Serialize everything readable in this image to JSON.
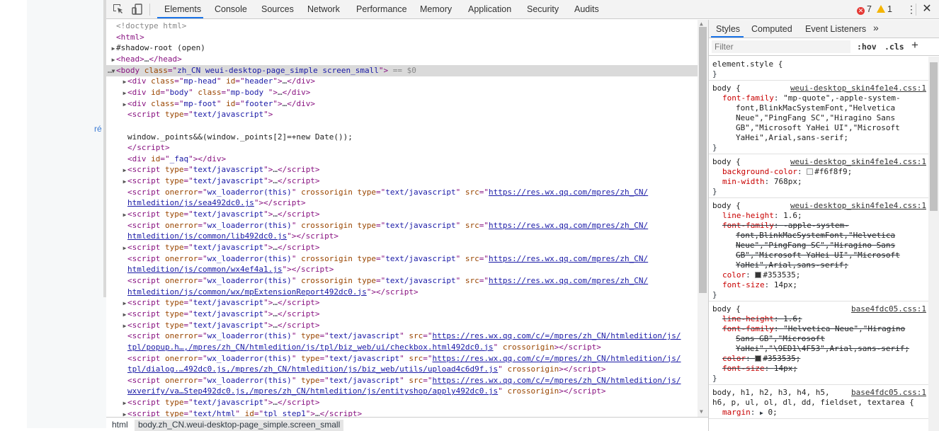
{
  "page": {
    "fragment": "ré"
  },
  "toolbar": {
    "tabs": [
      {
        "label": "Elements"
      },
      {
        "label": "Console"
      },
      {
        "label": "Sources"
      },
      {
        "label": "Network"
      },
      {
        "label": "Performance"
      },
      {
        "label": "Memory"
      },
      {
        "label": "Application"
      },
      {
        "label": "Security"
      },
      {
        "label": "Audits"
      }
    ],
    "error_count": "7",
    "warning_count": "1",
    "error_glyph": "✕",
    "close_glyph": "✕",
    "more_glyph": "⋮"
  },
  "elements": {
    "selected_suffix": " == $0",
    "ellipsis": "…"
  },
  "breadcrumb": {
    "items": [
      {
        "label": "html"
      },
      {
        "label": "body.zh_CN.weui-desktop-page_simple.screen_small"
      }
    ]
  },
  "styles": {
    "tabs": [
      {
        "label": "Styles"
      },
      {
        "label": "Computed"
      },
      {
        "label": "Event Listeners"
      },
      {
        "label": "»"
      }
    ],
    "filter_placeholder": "Filter",
    "hov": ":hov",
    "cls": ".cls",
    "plus": "+",
    "rules": [
      {
        "selector": "element.style {",
        "close": "}"
      },
      {
        "selector": "body {",
        "source": "weui-desktop_skin4fe1e4.css:1",
        "props": [
          {
            "name": "font-family",
            "value": "\"mp-quote\",-apple-system-"
          },
          {
            "cont": "font,BlinkMacSystemFont,\"Helvetica"
          },
          {
            "cont": "Neue\",\"PingFang SC\",\"Hiragino Sans"
          },
          {
            "cont": "GB\",\"Microsoft YaHei UI\",\"Microsoft"
          },
          {
            "cont": "YaHei\",Arial,sans-serif;"
          }
        ],
        "close": "}"
      },
      {
        "selector": "body {",
        "source": "weui-desktop_skin4fe1e4.css:1",
        "props": [
          {
            "name": "background-color",
            "value": "#f6f8f9;",
            "swatch": "#f6f8f9"
          },
          {
            "name": "min-width",
            "value": "768px;"
          }
        ],
        "close": "}"
      },
      {
        "selector": "body {",
        "source": "weui-desktop_skin4fe1e4.css:1",
        "props": [
          {
            "name": "line-height",
            "value": "1.6;"
          },
          {
            "name": "font-family",
            "value": "-apple-system-",
            "struck": true
          },
          {
            "cont": "font,BlinkMacSystemFont,\"Helvetica",
            "struck": true
          },
          {
            "cont": "Neue\",\"PingFang SC\",\"Hiragino Sans",
            "struck": true
          },
          {
            "cont": "GB\",\"Microsoft YaHei UI\",\"Microsoft",
            "struck": true
          },
          {
            "cont": "YaHei\",Arial,sans-serif;",
            "struck": true
          },
          {
            "name": "color",
            "value": "#353535;",
            "swatch": "#353535"
          },
          {
            "name": "font-size",
            "value": "14px;"
          }
        ],
        "close": "}"
      },
      {
        "selector": "body {",
        "source": "base4fdc05.css:1",
        "props": [
          {
            "name": "line-height",
            "value": "1.6;",
            "struck": true
          },
          {
            "name": "font-family",
            "value": "\"Helvetica Neue\",\"Hiragino",
            "struck": true
          },
          {
            "cont": "Sans GB\",\"Microsoft",
            "struck": true
          },
          {
            "cont": "YaHei\",\"\\9ED1\\4F53\",Arial,sans-serif;",
            "struck": true
          },
          {
            "name": "color",
            "value": "#353535;",
            "swatch": "#353535",
            "struck": true
          },
          {
            "name": "font-size",
            "value": "14px;",
            "struck": true
          }
        ],
        "close": "}"
      },
      {
        "selector": "body, h1, h2, h3, h4, h5,",
        "selector2": "h6, p, ul, ol, dl, dd, fieldset, textarea {",
        "source": "base4fdc05.css:1",
        "props": [
          {
            "name": "margin",
            "value": "0;",
            "arrow": "▶"
          }
        ]
      }
    ]
  },
  "dom_lines": [
    {
      "d": 0,
      "html": "<span class='cm'>&lt;!doctype html&gt;</span>"
    },
    {
      "d": 0,
      "html": "<span class='tag'>&lt;html&gt;</span>"
    },
    {
      "d": 0,
      "tri": "▶",
      "html": "<span class='tx'>#shadow-root (open)</span>"
    },
    {
      "d": 0,
      "tri": "▶",
      "html": "<span class='tag'>&lt;head&gt;</span>…<span class='tag'>&lt;/head&gt;</span>"
    },
    {
      "d": 0,
      "tri": "▼",
      "sel": true,
      "html": "<span class='tag'>&lt;body</span> <span class='an'>class</span><span class='tag'>=\"</span><span class='av'>zh_CN weui-desktop-page_simple  screen_small</span><span class='tag'>\"&gt;</span>"
    },
    {
      "d": 1,
      "tri": "▶",
      "html": "<span class='tag'>&lt;div</span> <span class='an'>class</span><span class='tag'>=\"</span><span class='av'>mp-head</span><span class='tag'>\"</span> <span class='an'>id</span><span class='tag'>=\"</span><span class='av'>header</span><span class='tag'>\"&gt;</span>…<span class='tag'>&lt;/div&gt;</span>"
    },
    {
      "d": 1,
      "tri": "▶",
      "html": "<span class='tag'>&lt;div</span> <span class='an'>id</span><span class='tag'>=\"</span><span class='av'>body</span><span class='tag'>\"</span> <span class='an'>class</span><span class='tag'>=\"</span><span class='av'>mp-body </span><span class='tag'>\"&gt;</span>…<span class='tag'>&lt;/div&gt;</span>"
    },
    {
      "d": 1,
      "tri": "▶",
      "html": "<span class='tag'>&lt;div</span> <span class='an'>class</span><span class='tag'>=\"</span><span class='av'>mp-foot</span><span class='tag'>\"</span> <span class='an'>id</span><span class='tag'>=\"</span><span class='av'>footer</span><span class='tag'>\"&gt;</span>…<span class='tag'>&lt;/div&gt;</span>"
    },
    {
      "d": 1,
      "html": "<span class='tag'>&lt;script</span> <span class='an'>type</span><span class='tag'>=\"</span><span class='av'>text/javascript</span><span class='tag'>\"&gt;</span>"
    },
    {
      "d": 1,
      "html": ""
    },
    {
      "d": 1,
      "html": "<span class='tx'>window._points&amp;&amp;(window._points[2]=+new Date());</span>"
    },
    {
      "d": 1,
      "html": "<span class='tag'>&lt;/script&gt;</span>"
    },
    {
      "d": 1,
      "html": "<span class='tag'>&lt;div</span> <span class='an'>id</span><span class='tag'>=\"</span><span class='av'>_faq</span><span class='tag'>\"&gt;&lt;/div&gt;</span>"
    },
    {
      "d": 1,
      "tri": "▶",
      "html": "<span class='tag'>&lt;script</span> <span class='an'>type</span><span class='tag'>=\"</span><span class='av'>text/javascript</span><span class='tag'>\"&gt;</span>…<span class='tag'>&lt;/script&gt;</span>"
    },
    {
      "d": 1,
      "tri": "▶",
      "html": "<span class='tag'>&lt;script</span> <span class='an'>type</span><span class='tag'>=\"</span><span class='av'>text/javascript</span><span class='tag'>\"&gt;</span>…<span class='tag'>&lt;/script&gt;</span>"
    },
    {
      "d": 1,
      "html": "<span class='tag'>&lt;script</span> <span class='an'>onerror</span><span class='tag'>=\"</span><span class='av'>wx_loaderror(this)</span><span class='tag'>\"</span> <span class='an'>crossorigin type</span><span class='tag'>=\"</span><span class='av'>text/javascript</span><span class='tag'>\"</span> <span class='an'>src</span><span class='tag'>=\"</span><span class='lk'>https://res.wx.qq.com/mpres/zh_CN/</span>"
    },
    {
      "d": 1,
      "html": "<span class='lk'>htmledition/js/sea492dc0.js</span><span class='tag'>\"&gt;&lt;/script&gt;</span>"
    },
    {
      "d": 1,
      "tri": "▶",
      "html": "<span class='tag'>&lt;script</span> <span class='an'>type</span><span class='tag'>=\"</span><span class='av'>text/javascript</span><span class='tag'>\"&gt;</span>…<span class='tag'>&lt;/script&gt;</span>"
    },
    {
      "d": 1,
      "html": "<span class='tag'>&lt;script</span> <span class='an'>onerror</span><span class='tag'>=\"</span><span class='av'>wx_loaderror(this)</span><span class='tag'>\"</span> <span class='an'>crossorigin type</span><span class='tag'>=\"</span><span class='av'>text/javascript</span><span class='tag'>\"</span> <span class='an'>src</span><span class='tag'>=\"</span><span class='lk'>https://res.wx.qq.com/mpres/zh_CN/</span>"
    },
    {
      "d": 1,
      "html": "<span class='lk'>htmledition/js/common/lib492dc0.js</span><span class='tag'>\"&gt;&lt;/script&gt;</span>"
    },
    {
      "d": 1,
      "tri": "▶",
      "html": "<span class='tag'>&lt;script</span> <span class='an'>type</span><span class='tag'>=\"</span><span class='av'>text/javascript</span><span class='tag'>\"&gt;</span>…<span class='tag'>&lt;/script&gt;</span>"
    },
    {
      "d": 1,
      "html": "<span class='tag'>&lt;script</span> <span class='an'>onerror</span><span class='tag'>=\"</span><span class='av'>wx_loaderror(this)</span><span class='tag'>\"</span> <span class='an'>crossorigin type</span><span class='tag'>=\"</span><span class='av'>text/javascript</span><span class='tag'>\"</span> <span class='an'>src</span><span class='tag'>=\"</span><span class='lk'>https://res.wx.qq.com/mpres/zh_CN/</span>"
    },
    {
      "d": 1,
      "html": "<span class='lk'>htmledition/js/common/wx4ef4a1.js</span><span class='tag'>\"&gt;&lt;/script&gt;</span>"
    },
    {
      "d": 1,
      "html": "<span class='tag'>&lt;script</span> <span class='an'>onerror</span><span class='tag'>=\"</span><span class='av'>wx_loaderror(this)</span><span class='tag'>\"</span> <span class='an'>crossorigin type</span><span class='tag'>=\"</span><span class='av'>text/javascript</span><span class='tag'>\"</span> <span class='an'>src</span><span class='tag'>=\"</span><span class='lk'>https://res.wx.qq.com/mpres/zh_CN/</span>"
    },
    {
      "d": 1,
      "html": "<span class='lk'>htmledition/js/common/wx/mpExtensionReport492dc0.js</span><span class='tag'>\"&gt;&lt;/script&gt;</span>"
    },
    {
      "d": 1,
      "tri": "▶",
      "html": "<span class='tag'>&lt;script</span> <span class='an'>type</span><span class='tag'>=\"</span><span class='av'>text/javascript</span><span class='tag'>\"&gt;</span>…<span class='tag'>&lt;/script&gt;</span>"
    },
    {
      "d": 1,
      "tri": "▶",
      "html": "<span class='tag'>&lt;script</span> <span class='an'>type</span><span class='tag'>=\"</span><span class='av'>text/javascript</span><span class='tag'>\"&gt;</span>…<span class='tag'>&lt;/script&gt;</span>"
    },
    {
      "d": 1,
      "tri": "▶",
      "html": "<span class='tag'>&lt;script</span> <span class='an'>type</span><span class='tag'>=\"</span><span class='av'>text/javascript</span><span class='tag'>\"&gt;</span>…<span class='tag'>&lt;/script&gt;</span>"
    },
    {
      "d": 1,
      "html": "<span class='tag'>&lt;script</span> <span class='an'>onerror</span><span class='tag'>=\"</span><span class='av'>wx_loaderror(this)</span><span class='tag'>\"</span> <span class='an'>type</span><span class='tag'>=\"</span><span class='av'>text/javascript</span><span class='tag'>\"</span> <span class='an'>src</span><span class='tag'>=\"</span><span class='lk'>https://res.wx.qq.com/c/=/mpres/zh_CN/htmledition/js/</span>"
    },
    {
      "d": 1,
      "html": "<span class='lk'>tpl/popup.h…,/mpres/zh_CN/htmledition/js/tpl/biz_web/ui/checkbox.html492dc0.js</span><span class='tag'>\"</span> <span class='an'>crossorigin</span><span class='tag'>&gt;&lt;/script&gt;</span>"
    },
    {
      "d": 1,
      "html": "<span class='tag'>&lt;script</span> <span class='an'>onerror</span><span class='tag'>=\"</span><span class='av'>wx_loaderror(this)</span><span class='tag'>\"</span> <span class='an'>type</span><span class='tag'>=\"</span><span class='av'>text/javascript</span><span class='tag'>\"</span> <span class='an'>src</span><span class='tag'>=\"</span><span class='lk'>https://res.wx.qq.com/c/=/mpres/zh_CN/htmledition/js/</span>"
    },
    {
      "d": 1,
      "html": "<span class='lk'>tpl/dialog.…492dc0.js,/mpres/zh_CN/htmledition/js/biz_web/utils/upload4c6d9f.js</span><span class='tag'>\"</span> <span class='an'>crossorigin</span><span class='tag'>&gt;&lt;/script&gt;</span>"
    },
    {
      "d": 1,
      "html": "<span class='tag'>&lt;script</span> <span class='an'>onerror</span><span class='tag'>=\"</span><span class='av'>wx_loaderror(this)</span><span class='tag'>\"</span> <span class='an'>type</span><span class='tag'>=\"</span><span class='av'>text/javascript</span><span class='tag'>\"</span> <span class='an'>src</span><span class='tag'>=\"</span><span class='lk'>https://res.wx.qq.com/c/=/mpres/zh_CN/htmledition/js/</span>"
    },
    {
      "d": 1,
      "html": "<span class='lk'>wxverify/va…Step492dc0.js,/mpres/zh_CN/htmledition/js/entityshop/apply492dc0.js</span><span class='tag'>\"</span> <span class='an'>crossorigin</span><span class='tag'>&gt;&lt;/script&gt;</span>"
    },
    {
      "d": 1,
      "tri": "▶",
      "html": "<span class='tag'>&lt;script</span> <span class='an'>type</span><span class='tag'>=\"</span><span class='av'>text/javascript</span><span class='tag'>\"&gt;</span>…<span class='tag'>&lt;/script&gt;</span>"
    },
    {
      "d": 1,
      "tri": "▶",
      "html": "<span class='tag'>&lt;script</span> <span class='an'>type</span><span class='tag'>=\"</span><span class='av'>text/html</span><span class='tag'>\"</span> <span class='an'>id</span><span class='tag'>=\"</span><span class='av'>tpl_step1</span><span class='tag'>\"&gt;</span>…<span class='tag'>&lt;/script&gt;</span>"
    }
  ]
}
